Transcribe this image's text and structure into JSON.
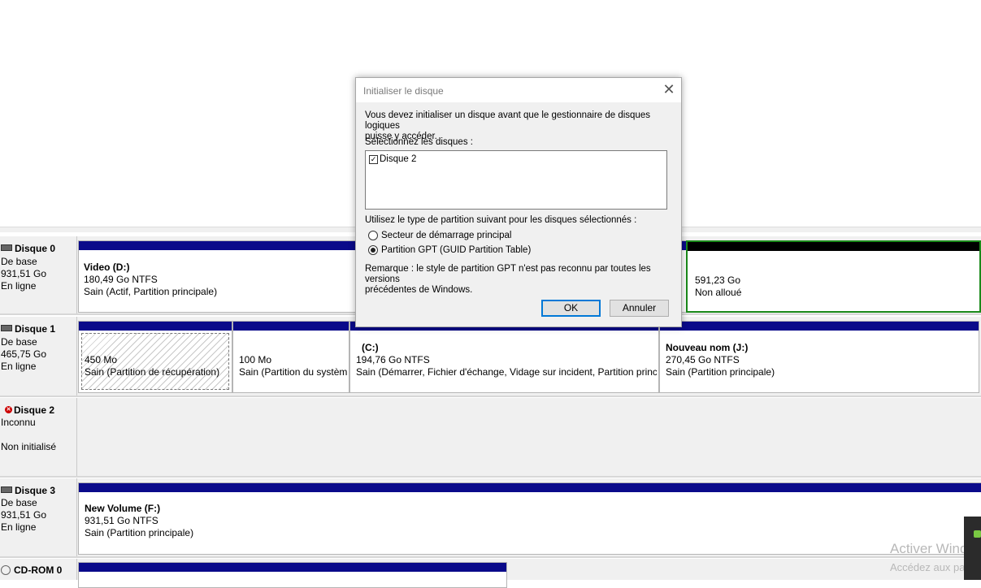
{
  "dialog": {
    "title": "Initialiser le disque",
    "close_glyph": "✕",
    "intro_line1": "Vous devez initialiser un disque avant que le gestionnaire de disques logiques",
    "intro_line2": "puisse y accéder.",
    "select_label": "Sélectionnez les disques :",
    "disk_items": [
      {
        "label": "Disque 2",
        "checked": true
      }
    ],
    "partition_style_label": "Utilisez le type de partition suivant pour les disques sélectionnés :",
    "options": [
      {
        "label": "Secteur de démarrage principal",
        "selected": false
      },
      {
        "label": "Partition GPT (GUID Partition Table)",
        "selected": true
      }
    ],
    "note_line1": "Remarque : le style de partition GPT n'est pas reconnu par toutes les versions",
    "note_line2": "précédentes de Windows.",
    "ok_label": "OK",
    "cancel_label": "Annuler"
  },
  "disks": [
    {
      "name": "Disque 0",
      "type": "De base",
      "size": "931,51 Go",
      "status": "En ligne",
      "partitions": [
        {
          "name": "Video  (D:)",
          "size": "180,49 Go NTFS",
          "status": "Sain (Actif, Partition principale)"
        },
        {
          "name": "",
          "size": "591,23 Go",
          "status": "Non alloué"
        }
      ]
    },
    {
      "name": "Disque 1",
      "type": "De base",
      "size": "465,75 Go",
      "status": "En ligne",
      "partitions": [
        {
          "name": "",
          "size": "450 Mo",
          "status": "Sain (Partition de récupération)"
        },
        {
          "name": "",
          "size": "100 Mo",
          "status": "Sain (Partition du systèm"
        },
        {
          "name": "(C:)",
          "size": "194,76 Go NTFS",
          "status": "Sain (Démarrer, Fichier d'échange, Vidage sur incident, Partition princ"
        },
        {
          "name": "Nouveau nom  (J:)",
          "size": "270,45 Go NTFS",
          "status": "Sain (Partition principale)"
        }
      ]
    },
    {
      "name": "Disque 2",
      "type": "Inconnu",
      "size": "",
      "status": "Non initialisé",
      "partitions": []
    },
    {
      "name": "Disque 3",
      "type": "De base",
      "size": "931,51 Go",
      "status": "En ligne",
      "partitions": [
        {
          "name": "New Volume  (F:)",
          "size": "931,51 Go NTFS",
          "status": "Sain (Partition principale)"
        }
      ]
    },
    {
      "name": "CD-ROM 0",
      "partitions": []
    }
  ],
  "watermark": {
    "line1": "Activer Wind",
    "line2": "Accédez aux pa"
  },
  "colors": {
    "primary_partition_bar": "#0a0a8a",
    "unallocated_bar": "#000000",
    "unallocated_border": "#1a8a1a"
  }
}
